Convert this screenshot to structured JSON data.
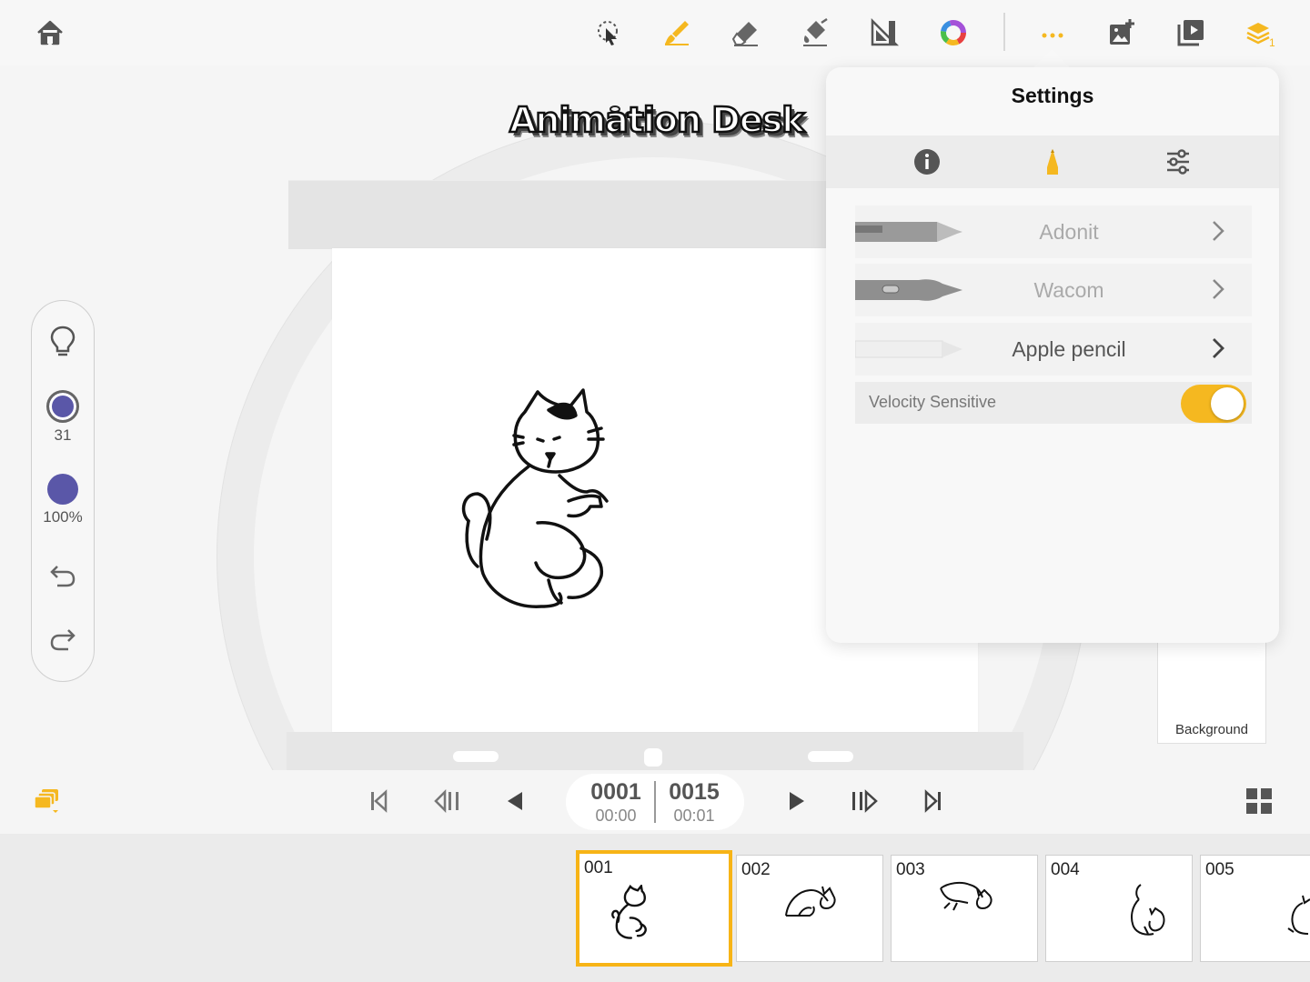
{
  "toolbar": {
    "icons": [
      "home-icon",
      "lasso-select-icon",
      "brush-icon",
      "eraser-icon",
      "fill-bucket-icon",
      "ruler-icon",
      "color-wheel-icon",
      "more-icon",
      "add-image-icon",
      "play-preview-icon",
      "layers-icon"
    ],
    "layers_badge": "1",
    "accent_color": "#f5b820"
  },
  "logo": {
    "text": "Animation Desk"
  },
  "side_panel": {
    "brush_size": "31",
    "opacity": "100%",
    "brush_color": "#5a57a8"
  },
  "background_card": {
    "label": "Background"
  },
  "settings": {
    "title": "Settings",
    "tabs": [
      "info-tab",
      "stylus-tab",
      "preferences-tab"
    ],
    "active_tab": "stylus-tab",
    "pens": [
      {
        "name": "Adonit",
        "active": false
      },
      {
        "name": "Wacom",
        "active": false
      },
      {
        "name": "Apple pencil",
        "active": true
      }
    ],
    "velocity": {
      "label": "Velocity Sensitive",
      "enabled": true
    }
  },
  "playback": {
    "current_frame": "0001",
    "current_time": "00:00",
    "total_frames": "0015",
    "total_time": "00:01"
  },
  "frames": [
    {
      "num": "001",
      "selected": true
    },
    {
      "num": "002",
      "selected": false
    },
    {
      "num": "003",
      "selected": false
    },
    {
      "num": "004",
      "selected": false
    },
    {
      "num": "005",
      "selected": false
    }
  ]
}
